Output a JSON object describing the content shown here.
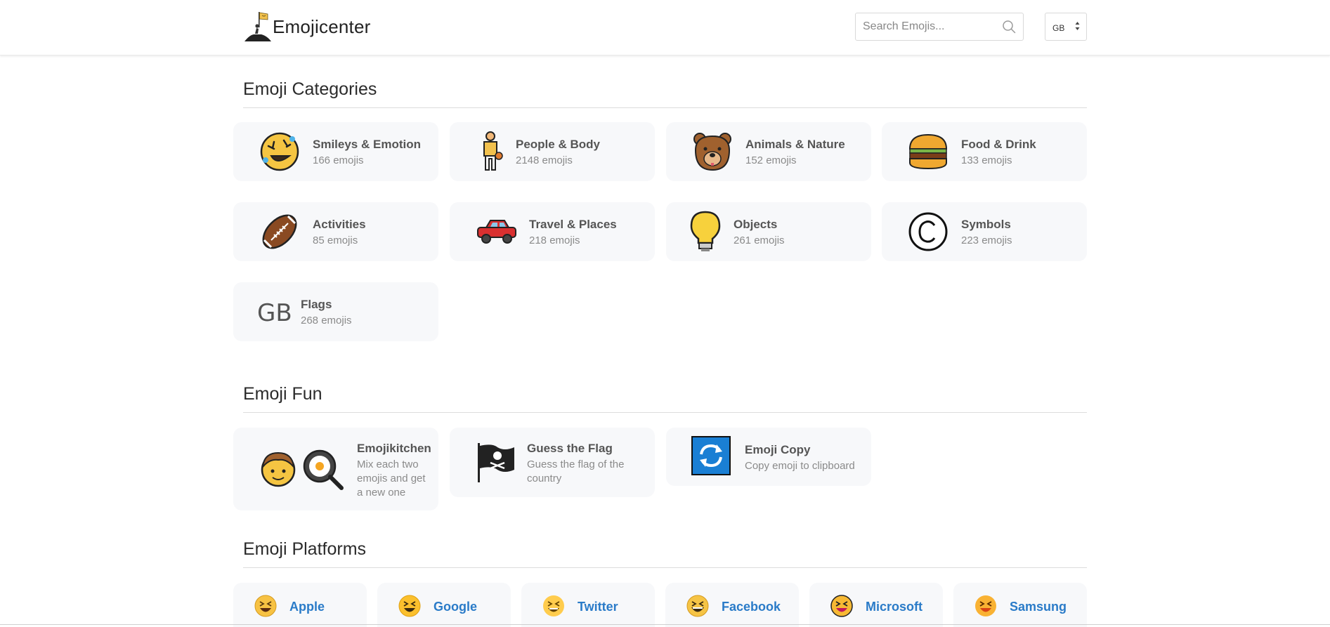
{
  "header": {
    "brand": "Emojicenter",
    "search_placeholder": "Search Emojis...",
    "language": "GB"
  },
  "categories": {
    "title": "Emoji Categories",
    "items": [
      {
        "name": "Smileys & Emotion",
        "count": "166 emojis",
        "icon": "rolling-laughing-face-icon"
      },
      {
        "name": "People & Body",
        "count": "2148 emojis",
        "icon": "person-basketball-icon"
      },
      {
        "name": "Animals & Nature",
        "count": "152 emojis",
        "icon": "bear-face-icon"
      },
      {
        "name": "Food & Drink",
        "count": "133 emojis",
        "icon": "hamburger-icon"
      },
      {
        "name": "Activities",
        "count": "85 emojis",
        "icon": "american-football-icon"
      },
      {
        "name": "Travel & Places",
        "count": "218 emojis",
        "icon": "red-car-icon"
      },
      {
        "name": "Objects",
        "count": "261 emojis",
        "icon": "light-bulb-icon"
      },
      {
        "name": "Symbols",
        "count": "223 emojis",
        "icon": "copyright-symbol-icon"
      },
      {
        "name": "Flags",
        "count": "268 emojis",
        "icon_text": "GB"
      }
    ]
  },
  "fun": {
    "title": "Emoji Fun",
    "items": [
      {
        "name": "Emojikitchen",
        "desc": "Mix each two emojis and get a new one",
        "icon": "boy-face-and-frying-pan-icon"
      },
      {
        "name": "Guess the Flag",
        "desc": "Guess the flag of the country",
        "icon": "pirate-flag-icon"
      },
      {
        "name": "Emoji Copy",
        "desc": "Copy emoji to clipboard",
        "icon": "refresh-arrows-icon"
      }
    ]
  },
  "platforms": {
    "title": "Emoji Platforms",
    "items": [
      {
        "name": "Apple"
      },
      {
        "name": "Google"
      },
      {
        "name": "Twitter"
      },
      {
        "name": "Facebook"
      },
      {
        "name": "Microsoft"
      },
      {
        "name": "Samsung"
      }
    ]
  },
  "colors": {
    "card_bg": "#f7f8fa",
    "platform_link": "#2a7bc8",
    "emoji_yellow": "#f5c542"
  }
}
